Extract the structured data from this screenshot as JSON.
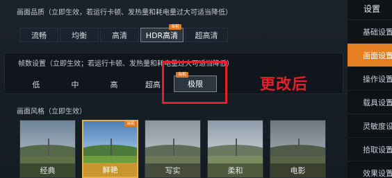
{
  "quality": {
    "title": "画面品质（立即生效，若运行卡顿、发热量和耗电量过大可适当降低）",
    "options": [
      "流畅",
      "均衡",
      "高清",
      "HDR高清",
      "超高清"
    ],
    "selected": "HDR高清",
    "tag": "当前"
  },
  "frames": {
    "title": "帧数设置（立即生效；若运行卡顿、发热量和耗电量过大可适当降低）",
    "options": [
      "低",
      "中",
      "高",
      "超高",
      "极限"
    ],
    "selected": "极限",
    "tag": "当前"
  },
  "annotation": "更改后",
  "style": {
    "title": "画面风格（立即生效）",
    "options": [
      "经典",
      "鲜艳",
      "写实",
      "柔和",
      "电影"
    ],
    "selected": "鲜艳",
    "tag": "当前"
  },
  "sidebar": {
    "title": "设置",
    "items": [
      "基础设置",
      "画面设置",
      "操作设置",
      "载具设置",
      "灵敏度设置",
      "拾取设置",
      "效果设置"
    ],
    "active": "画面设置"
  },
  "colors": {
    "accent": "#e47f22",
    "annotation": "#e41f2a"
  }
}
